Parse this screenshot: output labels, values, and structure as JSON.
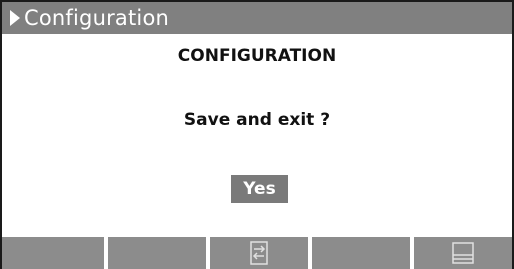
{
  "window": {
    "title": "Configuration",
    "title_icon": "play-arrow-icon"
  },
  "dialog": {
    "heading": "CONFIGURATION",
    "question": "Save and exit ?",
    "confirm_label": "Yes"
  },
  "softkeys": [
    {
      "icon": ""
    },
    {
      "icon": ""
    },
    {
      "icon": "list-exchange-icon"
    },
    {
      "icon": ""
    },
    {
      "icon": "layout-split-icon"
    }
  ],
  "colors": {
    "title_bar": "#808080",
    "softkey": "#8c8c8c",
    "button": "#7a7a7a"
  }
}
